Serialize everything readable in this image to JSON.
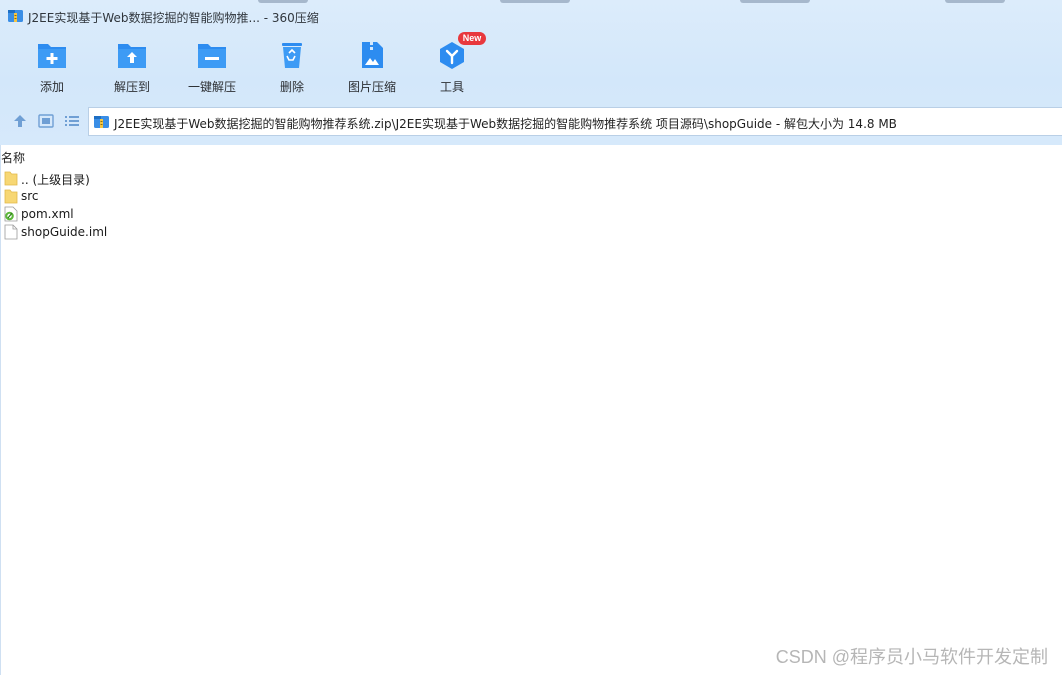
{
  "window": {
    "title": "J2EE实现基于Web数据挖掘的智能购物推... - 360压缩",
    "accent": "#2d8cf0",
    "chrome_bg": "#d6e9fb"
  },
  "toolbar": {
    "add_label": "添加",
    "extract_to_label": "解压到",
    "one_click_extract_label": "一键解压",
    "delete_label": "删除",
    "image_compress_label": "图片压缩",
    "tools_label": "工具",
    "new_badge": "New"
  },
  "navigation": {
    "up_icon": "arrow-up-icon",
    "thumbnail_icon": "thumbnail-view-icon",
    "list_icon": "list-view-icon"
  },
  "address_bar": {
    "path": "J2EE实现基于Web数据挖掘的智能购物推荐系统.zip\\J2EE实现基于Web数据挖掘的智能购物推荐系统 项目源码\\shopGuide - 解包大小为 14.8 MB"
  },
  "file_list": {
    "column_name": "名称",
    "items": [
      {
        "name": ".. (上级目录)",
        "icon": "folder-icon"
      },
      {
        "name": "src",
        "icon": "folder-icon"
      },
      {
        "name": "pom.xml",
        "icon": "xml-file-icon"
      },
      {
        "name": "shopGuide.iml",
        "icon": "file-icon"
      }
    ]
  },
  "watermark": "CSDN @程序员小马软件开发定制"
}
